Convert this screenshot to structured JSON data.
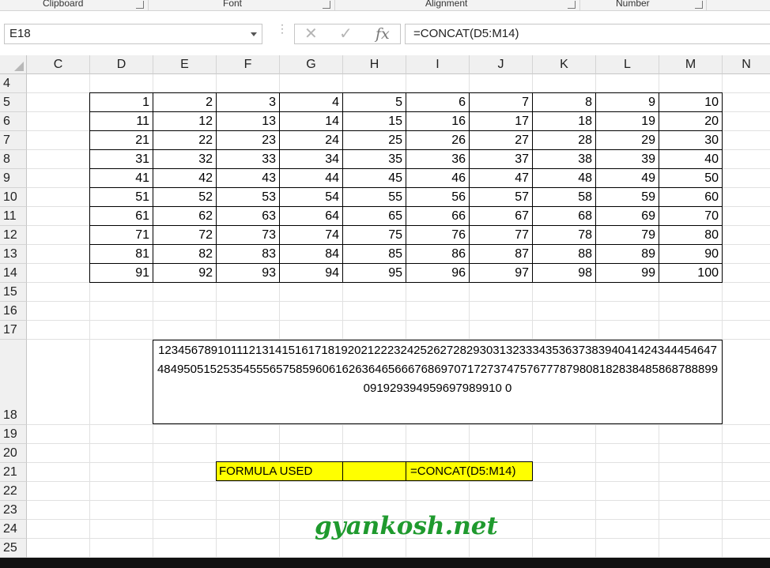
{
  "ribbon": {
    "groups": [
      {
        "label": "Clipboard"
      },
      {
        "label": "Font"
      },
      {
        "label": "Alignment"
      },
      {
        "label": "Number"
      }
    ]
  },
  "formula_bar": {
    "name_box": "E18",
    "fx_symbol": "fx",
    "cancel_symbol": "✕",
    "enter_symbol": "✓",
    "formula": "=CONCAT(D5:M14)"
  },
  "columns": [
    "C",
    "D",
    "E",
    "F",
    "G",
    "H",
    "I",
    "J",
    "K",
    "L",
    "M",
    "N"
  ],
  "rows": [
    "4",
    "5",
    "6",
    "7",
    "8",
    "9",
    "10",
    "11",
    "12",
    "13",
    "14",
    "15",
    "16",
    "17",
    "18",
    "19",
    "20",
    "21",
    "22",
    "23",
    "24",
    "25"
  ],
  "table": [
    [
      "1",
      "2",
      "3",
      "4",
      "5",
      "6",
      "7",
      "8",
      "9",
      "10"
    ],
    [
      "11",
      "12",
      "13",
      "14",
      "15",
      "16",
      "17",
      "18",
      "19",
      "20"
    ],
    [
      "21",
      "22",
      "23",
      "24",
      "25",
      "26",
      "27",
      "28",
      "29",
      "30"
    ],
    [
      "31",
      "32",
      "33",
      "34",
      "35",
      "36",
      "37",
      "38",
      "39",
      "40"
    ],
    [
      "41",
      "42",
      "43",
      "44",
      "45",
      "46",
      "47",
      "48",
      "49",
      "50"
    ],
    [
      "51",
      "52",
      "53",
      "54",
      "55",
      "56",
      "57",
      "58",
      "59",
      "60"
    ],
    [
      "61",
      "62",
      "63",
      "64",
      "65",
      "66",
      "67",
      "68",
      "69",
      "70"
    ],
    [
      "71",
      "72",
      "73",
      "74",
      "75",
      "76",
      "77",
      "78",
      "79",
      "80"
    ],
    [
      "81",
      "82",
      "83",
      "84",
      "85",
      "86",
      "87",
      "88",
      "89",
      "90"
    ],
    [
      "91",
      "92",
      "93",
      "94",
      "95",
      "96",
      "97",
      "98",
      "99",
      "100"
    ]
  ],
  "result_cell": "12345678910111213141516171819202122232425262728293031323334353637383940414243444546474849505152535455565758596061626364656667686970717273747576777879808182838485868788899091929394959697989910 0",
  "formula_used": {
    "label": "FORMULA USED",
    "value": "=CONCAT(D5:M14)",
    "highlight_color": "#ffff00"
  },
  "watermark": "gyankosh.net"
}
